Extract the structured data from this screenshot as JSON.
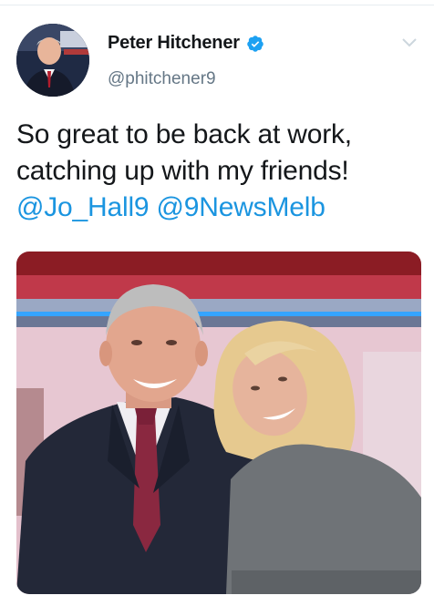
{
  "tweet": {
    "author": {
      "display_name": "Peter Hitchener",
      "handle": "@phitchener9",
      "verified": true,
      "avatar_icon": "avatar-photo"
    },
    "menu_icon": "chevron-down-icon",
    "text": {
      "line1": "So great to be back at work,",
      "line2": "catching up with my friends!",
      "mentions": [
        "@Jo_Hall9",
        "@9NewsMelb"
      ]
    },
    "photo": {
      "description_icon": "tweet-photo"
    }
  },
  "colors": {
    "link": "#1b95e0",
    "verified": "#1da1f2",
    "secondary_text": "#657786"
  }
}
